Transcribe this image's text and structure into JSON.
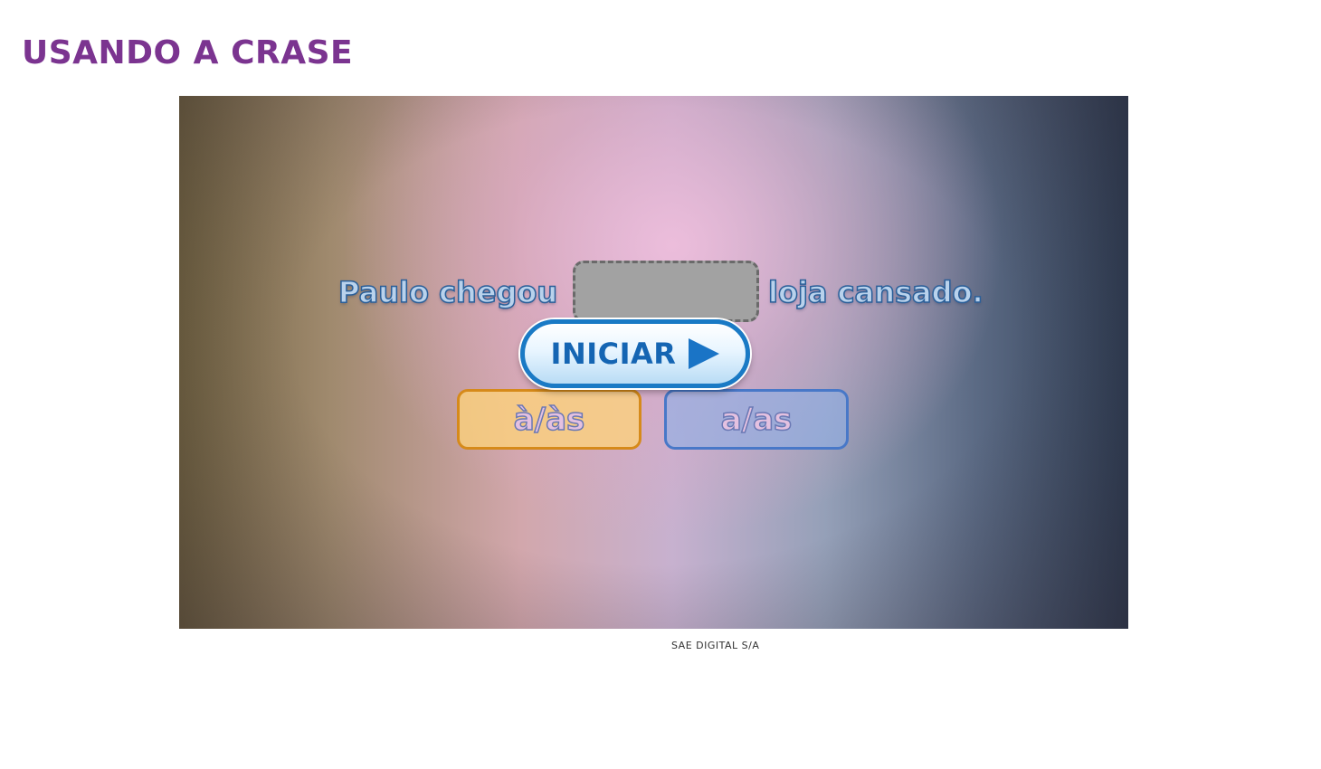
{
  "page": {
    "title": "USANDO A CRASE",
    "credit": "SAE DIGITAL S/A"
  },
  "activity": {
    "sentence_before": "Paulo chegou",
    "sentence_after": "loja cansado.",
    "start_button": "INICIAR",
    "options": [
      "à/às",
      "a/as"
    ]
  },
  "colors": {
    "title": "#7b3490",
    "start_button_border": "#1a7ac5",
    "option_crase_border": "#d68a1a",
    "option_sem_border": "#4878c8"
  },
  "icons": {
    "start": "play-icon"
  }
}
